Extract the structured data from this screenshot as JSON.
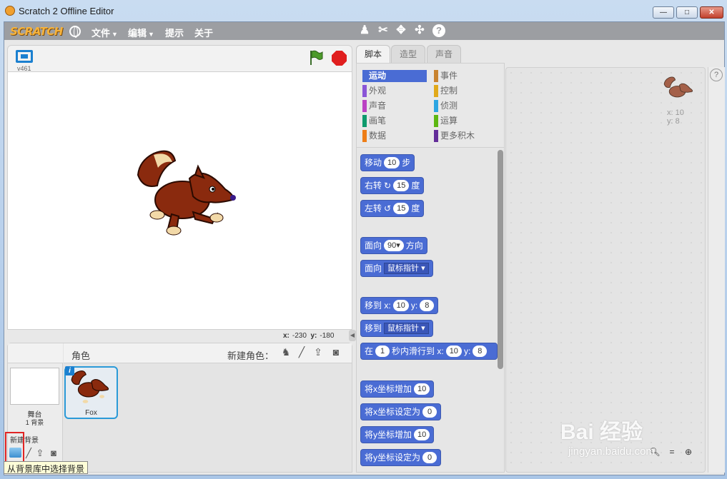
{
  "window": {
    "title": "Scratch 2 Offline Editor",
    "min": "—",
    "max": "□",
    "close": "✕"
  },
  "menubar": {
    "logo": "SCRATCH",
    "file": "文件",
    "edit": "编辑",
    "tips": "提示",
    "about": "关于",
    "tools": [
      "stamp-icon",
      "cut-icon",
      "grow-icon",
      "shrink-icon",
      "help-icon"
    ]
  },
  "stage": {
    "version": "v461",
    "coords_x_label": "x:",
    "coords_x": "-230",
    "coords_y_label": "y:",
    "coords_y": "-180"
  },
  "sprites": {
    "title": "角色",
    "new_sprite_label": "新建角色：",
    "stage_label": "舞台",
    "backdrop_count": "1 背景",
    "new_backdrop_label": "新建背景",
    "tooltip": "从背景库中选择背景",
    "items": [
      {
        "name": "Fox"
      }
    ]
  },
  "tabs": {
    "scripts": "脚本",
    "costumes": "造型",
    "sounds": "声音"
  },
  "categories": [
    {
      "label": "运动",
      "color": "#4a6cd4"
    },
    {
      "label": "事件",
      "color": "#c88330"
    },
    {
      "label": "外观",
      "color": "#8a55d7"
    },
    {
      "label": "控制",
      "color": "#e1a91a"
    },
    {
      "label": "声音",
      "color": "#bb42c3"
    },
    {
      "label": "侦测",
      "color": "#2ca5e2"
    },
    {
      "label": "画笔",
      "color": "#0e9a6c"
    },
    {
      "label": "运算",
      "color": "#5cb712"
    },
    {
      "label": "数据",
      "color": "#ee7d16"
    },
    {
      "label": "更多积木",
      "color": "#632d99"
    }
  ],
  "blocks": {
    "move": {
      "label": "移动",
      "value": "10",
      "suffix": "步"
    },
    "turn_right": {
      "label": "右转",
      "icon": "↻",
      "value": "15",
      "suffix": "度"
    },
    "turn_left": {
      "label": "左转",
      "icon": "↺",
      "value": "15",
      "suffix": "度"
    },
    "point_dir": {
      "label": "面向",
      "value": "90▾",
      "suffix": "方向"
    },
    "point_towards": {
      "label": "面向",
      "value": "鼠标指针"
    },
    "goto_xy": {
      "label": "移到 x:",
      "x": "10",
      "y_label": "y:",
      "y": "8"
    },
    "goto": {
      "label": "移到",
      "value": "鼠标指针"
    },
    "glide": {
      "label": "在",
      "secs": "1",
      "mid": "秒内滑行到 x:",
      "x": "10",
      "y_label": "y:",
      "y": "8"
    },
    "change_x": {
      "label": "将x坐标增加",
      "value": "10"
    },
    "set_x": {
      "label": "将x坐标设定为",
      "value": "0"
    },
    "change_y": {
      "label": "将y坐标增加",
      "value": "10"
    },
    "set_y": {
      "label": "将y坐标设定为",
      "value": "0"
    }
  },
  "scripts_area": {
    "sprite_x": "x: 10",
    "sprite_y": "y: 8"
  },
  "watermark": {
    "text": "Bai 经验",
    "sub": "jingyan.baidu.com"
  }
}
